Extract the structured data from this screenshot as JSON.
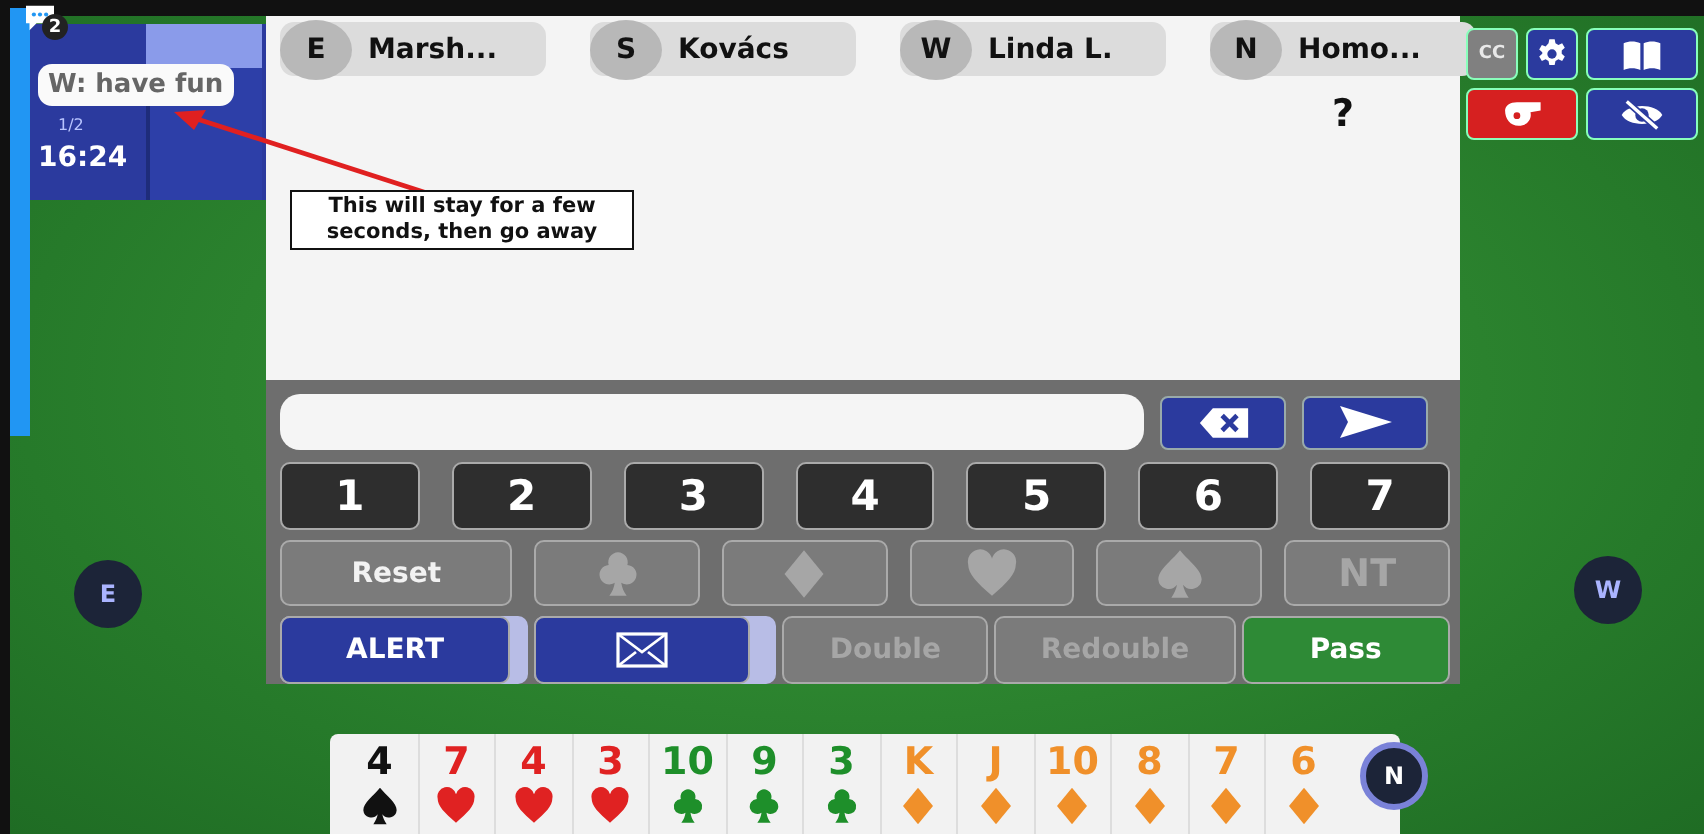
{
  "score_panel": {
    "chat_count": "2",
    "board": "1/2",
    "time": "16:24"
  },
  "chat_tooltip": "W: have fun",
  "annotation": "This will stay for a few seconds, then go away",
  "players": [
    {
      "seat": "E",
      "name": "Marsh..."
    },
    {
      "seat": "S",
      "name": "Kovács"
    },
    {
      "seat": "W",
      "name": "Linda L."
    },
    {
      "seat": "N",
      "name": "Homo...",
      "bid": "?"
    }
  ],
  "levels": [
    {
      "label": "1"
    },
    {
      "label": "2"
    },
    {
      "label": "3"
    },
    {
      "label": "4"
    },
    {
      "label": "5"
    },
    {
      "label": "6"
    },
    {
      "label": "7"
    }
  ],
  "strains": [
    {
      "kind": "reset",
      "label": "Reset",
      "disabled": false
    },
    {
      "kind": "clubs",
      "disabled": true
    },
    {
      "kind": "diamonds",
      "disabled": true
    },
    {
      "kind": "hearts",
      "disabled": true
    },
    {
      "kind": "spades",
      "disabled": true
    },
    {
      "kind": "nt",
      "label": "NT",
      "disabled": true
    }
  ],
  "actions": [
    {
      "kind": "alert",
      "label": "ALERT",
      "disabled": false
    },
    {
      "kind": "message",
      "disabled": false
    },
    {
      "kind": "double",
      "label": "Double",
      "disabled": true
    },
    {
      "kind": "redouble",
      "label": "Redouble",
      "disabled": true
    },
    {
      "kind": "pass",
      "label": "Pass",
      "disabled": false
    }
  ],
  "tools": [
    {
      "kind": "cc",
      "label": "CC"
    },
    {
      "kind": "settings"
    },
    {
      "kind": "book"
    },
    {
      "kind": "whistle"
    },
    {
      "kind": "hide"
    }
  ],
  "seats": {
    "left": "E",
    "right": "W",
    "bottom": "N"
  },
  "hand": [
    {
      "rank": "4",
      "kind": "spades"
    },
    {
      "rank": "7",
      "kind": "hearts"
    },
    {
      "rank": "4",
      "kind": "hearts"
    },
    {
      "rank": "3",
      "kind": "hearts"
    },
    {
      "rank": "10",
      "kind": "clubs"
    },
    {
      "rank": "9",
      "kind": "clubs"
    },
    {
      "rank": "3",
      "kind": "clubs"
    },
    {
      "rank": "K",
      "kind": "diamonds"
    },
    {
      "rank": "J",
      "kind": "diamonds"
    },
    {
      "rank": "10",
      "kind": "diamonds"
    },
    {
      "rank": "8",
      "kind": "diamonds"
    },
    {
      "rank": "7",
      "kind": "diamonds"
    },
    {
      "rank": "6",
      "kind": "diamonds"
    }
  ]
}
